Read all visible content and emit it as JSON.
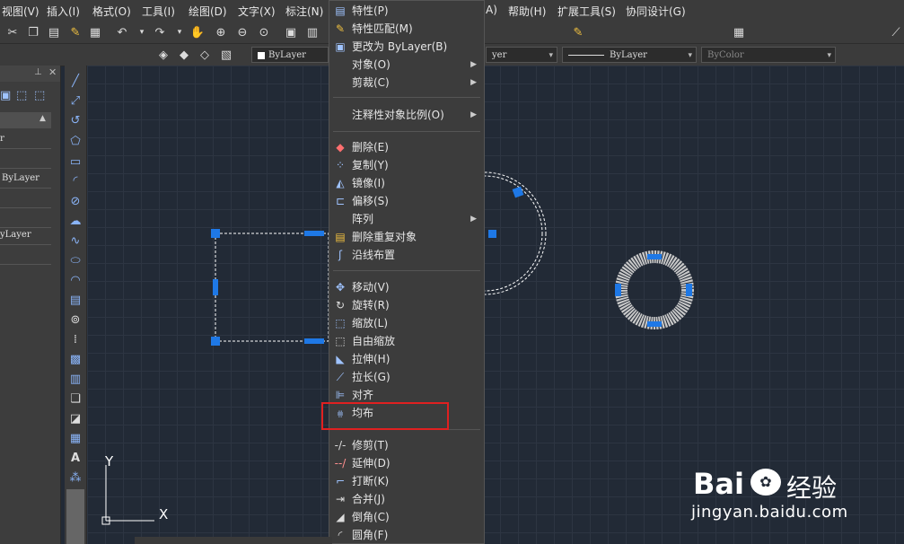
{
  "menubar": {
    "items": [
      "视图(V)",
      "插入(I)",
      "格式(O)",
      "工具(I)",
      "绘图(D)",
      "文字(X)",
      "标注(N)",
      "A)",
      "帮助(H)",
      "扩展工具(S)",
      "协同设计(G)"
    ]
  },
  "toolbar2": {
    "layer_combo": "ByLayer",
    "color_combo_right": "yer",
    "linetype_combo": "ByLayer",
    "plotstyle_combo": "ByColor"
  },
  "left_panel": {
    "rows": [
      "r",
      "ByLayer",
      "yLayer"
    ]
  },
  "context_menu": {
    "items": [
      {
        "label": "特性(P)",
        "icon": "properties-icon"
      },
      {
        "label": "特性匹配(M)",
        "icon": "match-properties-icon"
      },
      {
        "label": "更改为 ByLayer(B)",
        "icon": "change-bylayer-icon"
      },
      {
        "label": "对象(O)",
        "icon": "",
        "submenu": true
      },
      {
        "label": "剪裁(C)",
        "icon": "",
        "submenu": true
      },
      {
        "label": "注释性对象比例(O)",
        "icon": "",
        "submenu": true
      },
      {
        "label": "删除(E)",
        "icon": "erase-icon"
      },
      {
        "label": "复制(Y)",
        "icon": "copy-icon"
      },
      {
        "label": "镜像(I)",
        "icon": "mirror-icon"
      },
      {
        "label": "偏移(S)",
        "icon": "offset-icon"
      },
      {
        "label": "阵列",
        "icon": "",
        "submenu": true
      },
      {
        "label": "删除重复对象",
        "icon": "overkill-icon"
      },
      {
        "label": "沿线布置",
        "icon": "path-layout-icon"
      },
      {
        "label": "移动(V)",
        "icon": "move-icon"
      },
      {
        "label": "旋转(R)",
        "icon": "rotate-icon"
      },
      {
        "label": "缩放(L)",
        "icon": "scale-icon"
      },
      {
        "label": "自由缩放",
        "icon": "free-scale-icon"
      },
      {
        "label": "拉伸(H)",
        "icon": "stretch-icon"
      },
      {
        "label": "拉长(G)",
        "icon": "lengthen-icon"
      },
      {
        "label": "对齐",
        "icon": "align-icon"
      },
      {
        "label": "均布",
        "icon": "distribute-icon"
      },
      {
        "label": "修剪(T)",
        "icon": "trim-icon"
      },
      {
        "label": "延伸(D)",
        "icon": "extend-icon"
      },
      {
        "label": "打断(K)",
        "icon": "break-icon"
      },
      {
        "label": "合并(J)",
        "icon": "join-icon"
      },
      {
        "label": "倒角(C)",
        "icon": "chamfer-icon"
      },
      {
        "label": "圆角(F)",
        "icon": "fillet-icon"
      }
    ]
  },
  "canvas": {
    "ucs_x": "X",
    "ucs_y": "Y"
  },
  "watermark": {
    "brand": "Bai",
    "brand2": "经验",
    "url": "jingyan.baidu.com"
  },
  "colors": {
    "handle": "#1e78e6",
    "highlight": "#e02020",
    "canvas_bg": "#222a36"
  }
}
